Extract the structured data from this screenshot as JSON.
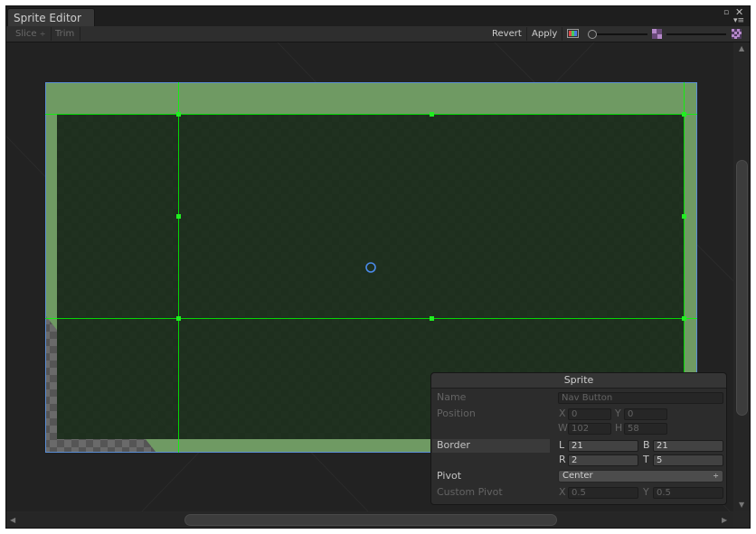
{
  "window": {
    "tab_title": "Sprite Editor"
  },
  "toolbar": {
    "slice_label": "Slice",
    "slice_caret": "÷",
    "trim_label": "Trim",
    "revert_label": "Revert",
    "apply_label": "Apply",
    "zoom_level": 0.0,
    "mip_level": 0.0
  },
  "colors": {
    "sprite_green": "#6f9a63",
    "handle_green": "#00ff00",
    "selection_blue": "#5b8fd6",
    "pivot_blue": "#4a8ae8",
    "panel_bg": "#2c2c2c"
  },
  "sprite_panel": {
    "title": "Sprite",
    "name_label": "Name",
    "name_value": "Nav Button",
    "position_label": "Position",
    "pos_x_label": "X",
    "pos_x": "0",
    "pos_y_label": "Y",
    "pos_y": "0",
    "pos_w_label": "W",
    "pos_w": "102",
    "pos_h_label": "H",
    "pos_h": "58",
    "border_label": "Border",
    "border_l_label": "L",
    "border_l": "21",
    "border_b_label": "B",
    "border_b": "21",
    "border_r_label": "R",
    "border_r": "2",
    "border_t_label": "T",
    "border_t": "5",
    "pivot_label": "Pivot",
    "pivot_value": "Center",
    "pivot_caret": "÷",
    "custom_pivot_label": "Custom Pivot",
    "cp_x_label": "X",
    "cp_x": "0.5",
    "cp_y_label": "Y",
    "cp_y": "0.5"
  },
  "scroll": {
    "horizontal_position": 0.5,
    "vertical_position": 0.5
  }
}
